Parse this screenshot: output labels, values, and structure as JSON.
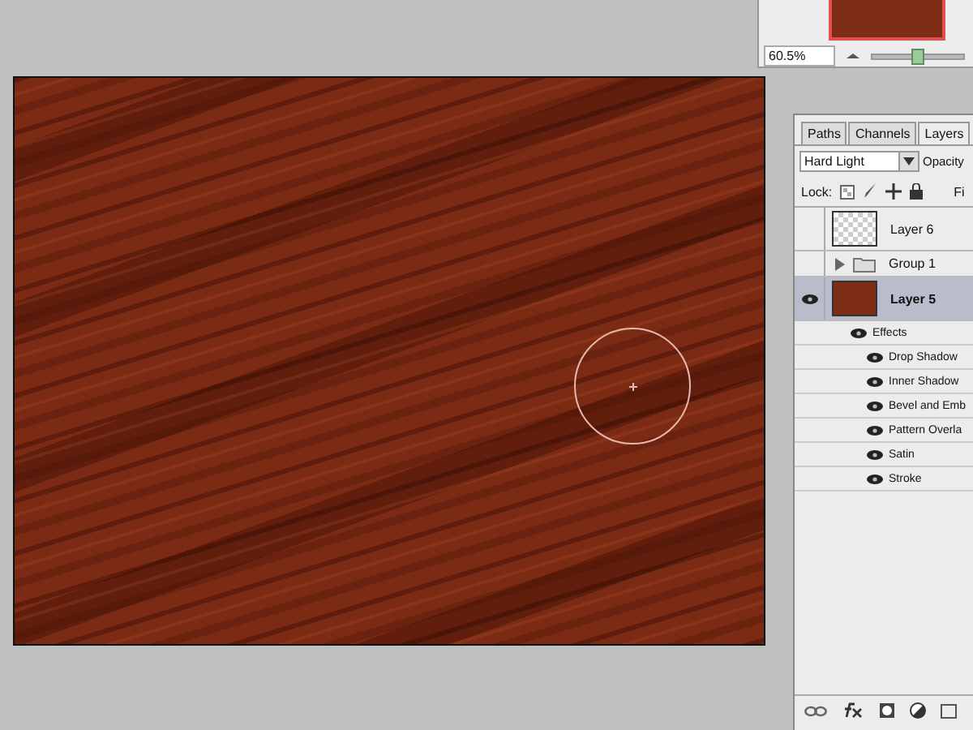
{
  "navigator": {
    "zoom": "60.5%",
    "slider": {
      "level": 0.48
    }
  },
  "layers_panel": {
    "tabs": [
      {
        "label": "Paths",
        "selected": false
      },
      {
        "label": "Channels",
        "selected": false
      },
      {
        "label": "Layers",
        "selected": true
      }
    ],
    "blend_mode": "Hard Light",
    "opacity_label": "Opacity",
    "lock_label": "Lock:",
    "fill_label": "Fi",
    "layers": [
      {
        "kind": "layer",
        "name": "Layer 6",
        "visible": false,
        "selected": false,
        "transparent": true
      },
      {
        "kind": "group",
        "name": "Group 1",
        "visible": false,
        "selected": false,
        "expanded": false
      },
      {
        "kind": "layer",
        "name": "Layer 5",
        "visible": true,
        "selected": true,
        "transparent": false,
        "effects": {
          "label": "Effects",
          "visible": true,
          "children": [
            {
              "name": "Drop Shadow",
              "visible": true
            },
            {
              "name": "Inner Shadow",
              "visible": true
            },
            {
              "name": "Bevel and Emb",
              "visible": true
            },
            {
              "name": "Pattern Overla",
              "visible": true
            },
            {
              "name": "Satin",
              "visible": true
            },
            {
              "name": "Stroke",
              "visible": true
            }
          ]
        }
      }
    ]
  }
}
